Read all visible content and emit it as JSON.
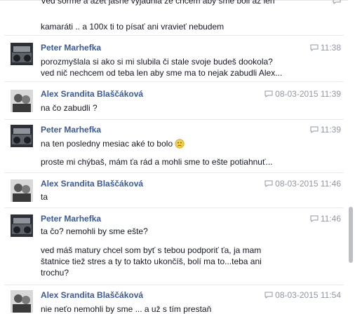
{
  "messages": [
    {
      "lines": [
        "Ved sorme a azet jasne vyjadrila ze chcem aby sme boli az len",
        "kamaráti .. a 100x ti to písať ani vravieť nebudem"
      ]
    },
    {
      "author": "Peter Marhefka",
      "time": "11:38",
      "lines": [
        "porozmyšlala si ako si mi slubila či stale svoje budeš dookola?",
        "ved nič nechcem od teba len aby sme ma to nejak zabudli Alex..."
      ]
    },
    {
      "author": "Alex Srandita Blaščáková",
      "time": "08-03-2015 11:39",
      "lines": [
        "na čo zabudli ?"
      ]
    },
    {
      "author": "Peter Marhefka",
      "time": "11:39",
      "lines": [
        "na ten posledny mesiac aké to bolo",
        "proste mi chýbaš, mám ťa rád a mohli sme to ešte potiahnuť..."
      ],
      "emoji": "slightly-frowning-face"
    },
    {
      "author": "Alex Srandita Blaščáková",
      "time": "08-03-2015 11:46",
      "lines": [
        "ta"
      ]
    },
    {
      "author": "Peter Marhefka",
      "time": "11:46",
      "lines": [
        "ta čo? nemohli by sme ešte?",
        "ved máš matury chcel som byť s tebou podporiť ťa, ja mam",
        "štatnice tiež stres a ty to takto ukončíš, bolí ma to...teba ani",
        "trochu?"
      ]
    },
    {
      "author": "Alex Srandita Blaščáková",
      "time": "08-03-2015 11:54",
      "lines": [
        "nie neťo nemohli by sme ... a už s tím prestaň"
      ]
    }
  ],
  "colors": {
    "author": "#3b5998",
    "meta": "#9197a3",
    "text": "#141823",
    "separator": "#e9eaed",
    "scrollbar": "#bcc0c6"
  },
  "icons": [
    "message-bubble-icon",
    "slightly-frowning-face-icon",
    "avatar-photo"
  ]
}
